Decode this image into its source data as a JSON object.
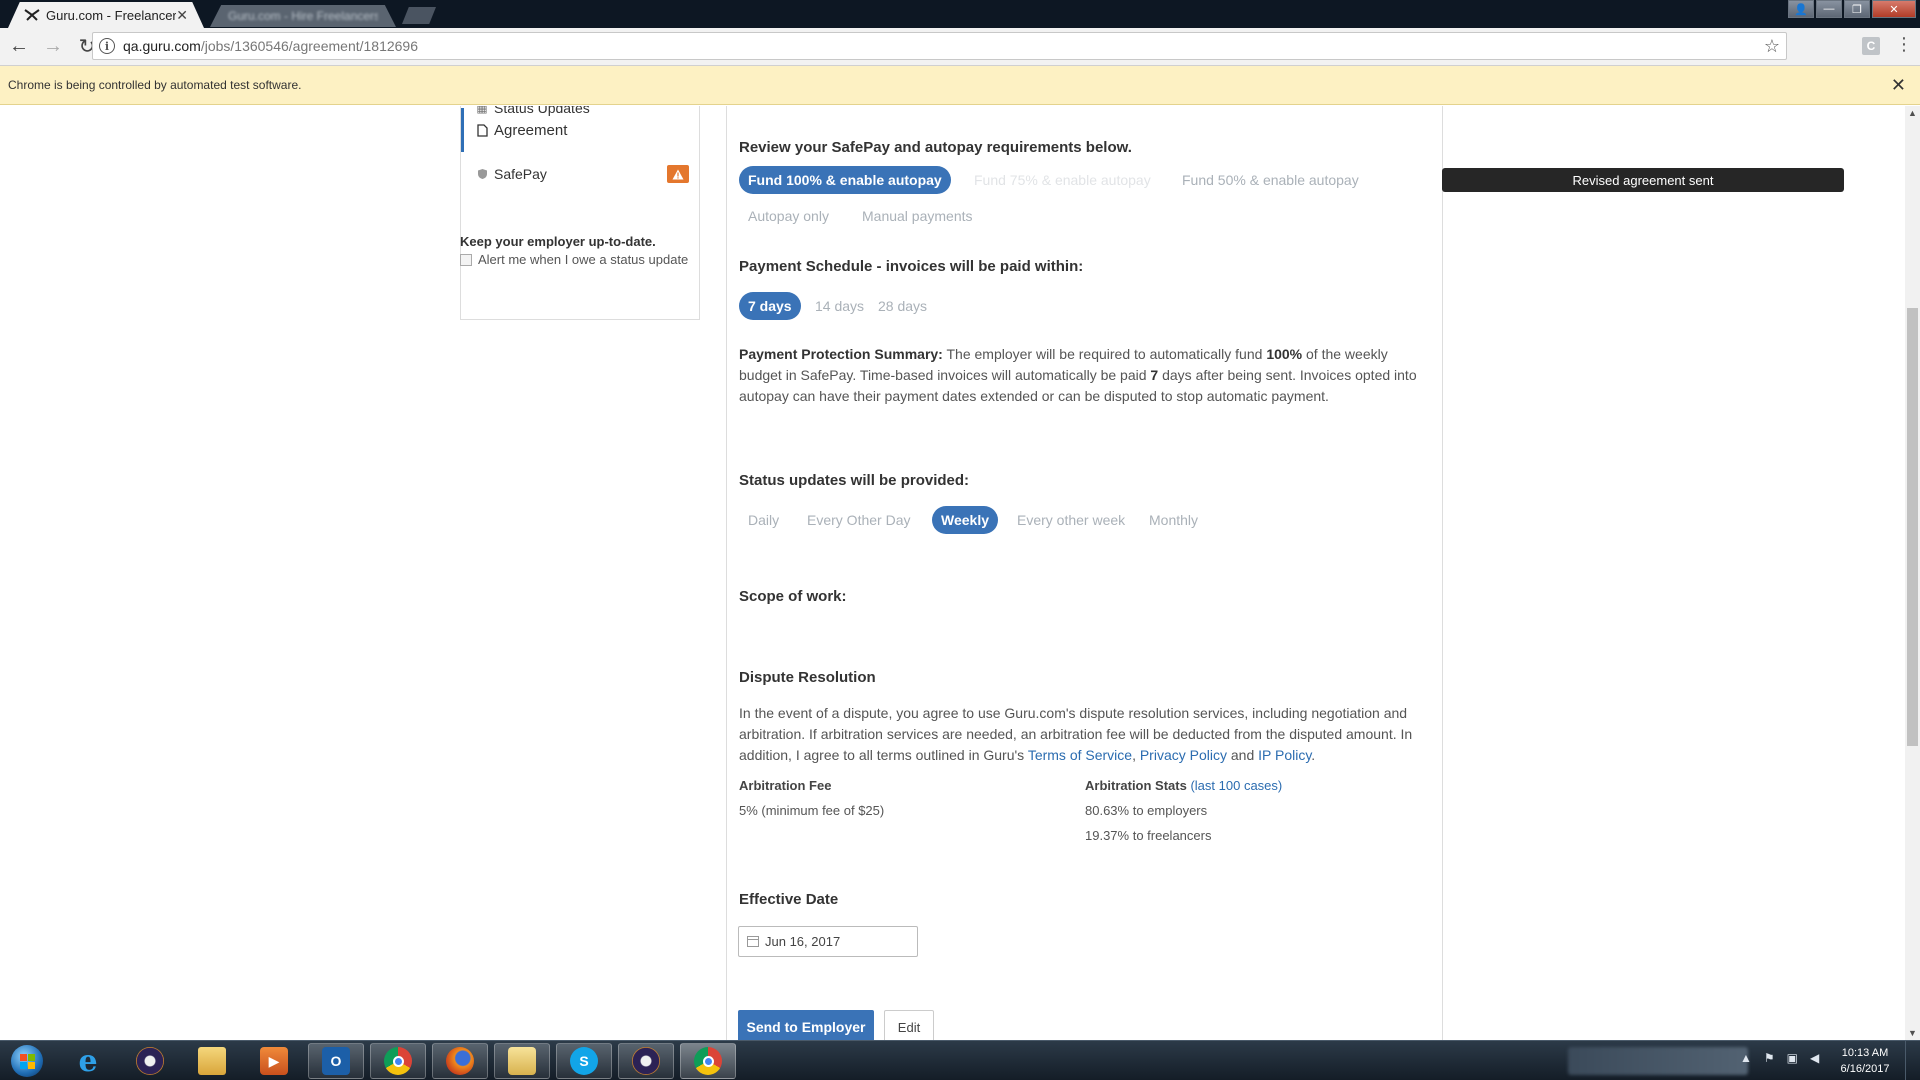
{
  "browser": {
    "active_tab_title": "Guru.com - Freelancer",
    "inactive_tab_title": "Guru.com - Hire Freelancers",
    "url_host": "qa.guru.com",
    "url_path": "/jobs/1360546/agreement/1812696",
    "infobar_text": "Chrome is being controlled by automated test software.",
    "extension_letter": "C"
  },
  "sidebar": {
    "items": [
      {
        "label": "Status Updates",
        "icon": "calendar-icon"
      },
      {
        "label": "Agreement",
        "icon": "document-icon"
      },
      {
        "label": "SafePay",
        "icon": "shield-icon",
        "badge": "!"
      }
    ],
    "keep_title": "Keep your employer up-to-date.",
    "alert_checkbox_label": "Alert me when I owe a status update"
  },
  "safepay": {
    "heading": "Review your SafePay and autopay requirements below.",
    "options": [
      "Fund 100% & enable autopay",
      "Fund 75% & enable autopay",
      "Fund 50% & enable autopay",
      "Autopay only",
      "Manual payments"
    ],
    "selected": "Fund 100% & enable autopay"
  },
  "tooltip": "Revised agreement sent",
  "schedule": {
    "heading": "Payment Schedule - invoices will be paid within:",
    "options": [
      "7 days",
      "14 days",
      "28 days"
    ],
    "selected": "7 days"
  },
  "protection": {
    "label": "Payment Protection Summary:",
    "text_1": " The employer will be required to automatically fund ",
    "percent": "100%",
    "text_2": " of the weekly budget in SafePay. Time-based invoices will automatically be paid ",
    "days": "7",
    "text_3": " days after being sent. Invoices opted into autopay can have their payment dates extended or can be disputed to stop automatic payment."
  },
  "status_updates": {
    "heading": "Status updates will be provided:",
    "options": [
      "Daily",
      "Every Other Day",
      "Weekly",
      "Every other week",
      "Monthly"
    ],
    "selected": "Weekly"
  },
  "scope": {
    "heading": "Scope of work:"
  },
  "dispute": {
    "heading": "Dispute Resolution",
    "text_1": "In the event of a dispute, you agree to use Guru.com's dispute resolution services, including negotiation and arbitration. If arbitration services are needed, an arbitration fee will be deducted from the disputed amount. In addition, I agree to all terms outlined in Guru's ",
    "link_terms": "Terms of Service",
    "sep_1": ", ",
    "link_privacy": "Privacy Policy",
    "sep_2": " and ",
    "link_ip": "IP Policy",
    "end": ".",
    "fee_label": "Arbitration Fee",
    "fee_value": "5% (minimum fee of $25)",
    "stats_label": "Arbitration Stats",
    "stats_link": "(last 100 cases)",
    "stats_employers": "80.63% to employers",
    "stats_freelancers": "19.37% to freelancers"
  },
  "effective": {
    "heading": "Effective Date",
    "date": "Jun 16, 2017"
  },
  "actions": {
    "send_label": "Send to Employer",
    "edit_label": "Edit"
  },
  "taskbar": {
    "clock_time": "10:13 AM",
    "clock_date": "6/16/2017"
  }
}
